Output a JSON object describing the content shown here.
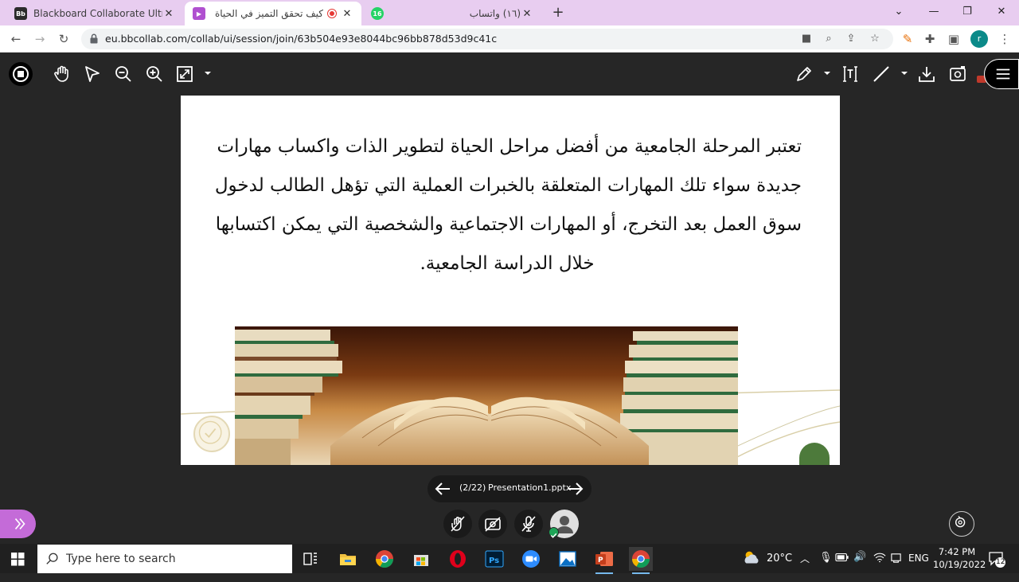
{
  "browser": {
    "tabs": [
      {
        "title": "Blackboard Collaborate Ultra – ن",
        "favicon": "Bb",
        "active": false
      },
      {
        "title": "كيف تحقق التميز في الحياة الجـ",
        "favicon": "",
        "active": true
      },
      {
        "title": "(١٦) واتساب",
        "favicon": "16",
        "active": false
      }
    ],
    "url": "eu.bbcollab.com/collab/ui/session/join/63b504e93e8044bc96bb878d53d9c41c",
    "profile_initial": "r"
  },
  "slide": {
    "body_lines": [
      "تعتبر المرحلة الجامعية من أفضل مراحل الحياة لتطوير الذات واكساب مهارات",
      "جديدة سواء تلك المهارات المتعلقة بالخبرات العملية التي تؤهل الطالب لدخول",
      "سوق العمل بعد التخرج، أو المهارات الاجتماعية والشخصية التي يمكن اكتسابها"
    ],
    "last_line": "خلال الدراسة الجامعية."
  },
  "slide_nav": {
    "counter": "(2/22)",
    "filename": "Presentation1.pptx"
  },
  "taskbar": {
    "search_placeholder": "Type here to search",
    "weather": "20°C",
    "language": "ENG",
    "time": "7:42 PM",
    "date": "10/19/2022",
    "notifications": "12"
  },
  "colors": {
    "tab_strip": "#e8cdf0",
    "collab_bg": "#262626",
    "side_toggle": "#c46bd8"
  }
}
